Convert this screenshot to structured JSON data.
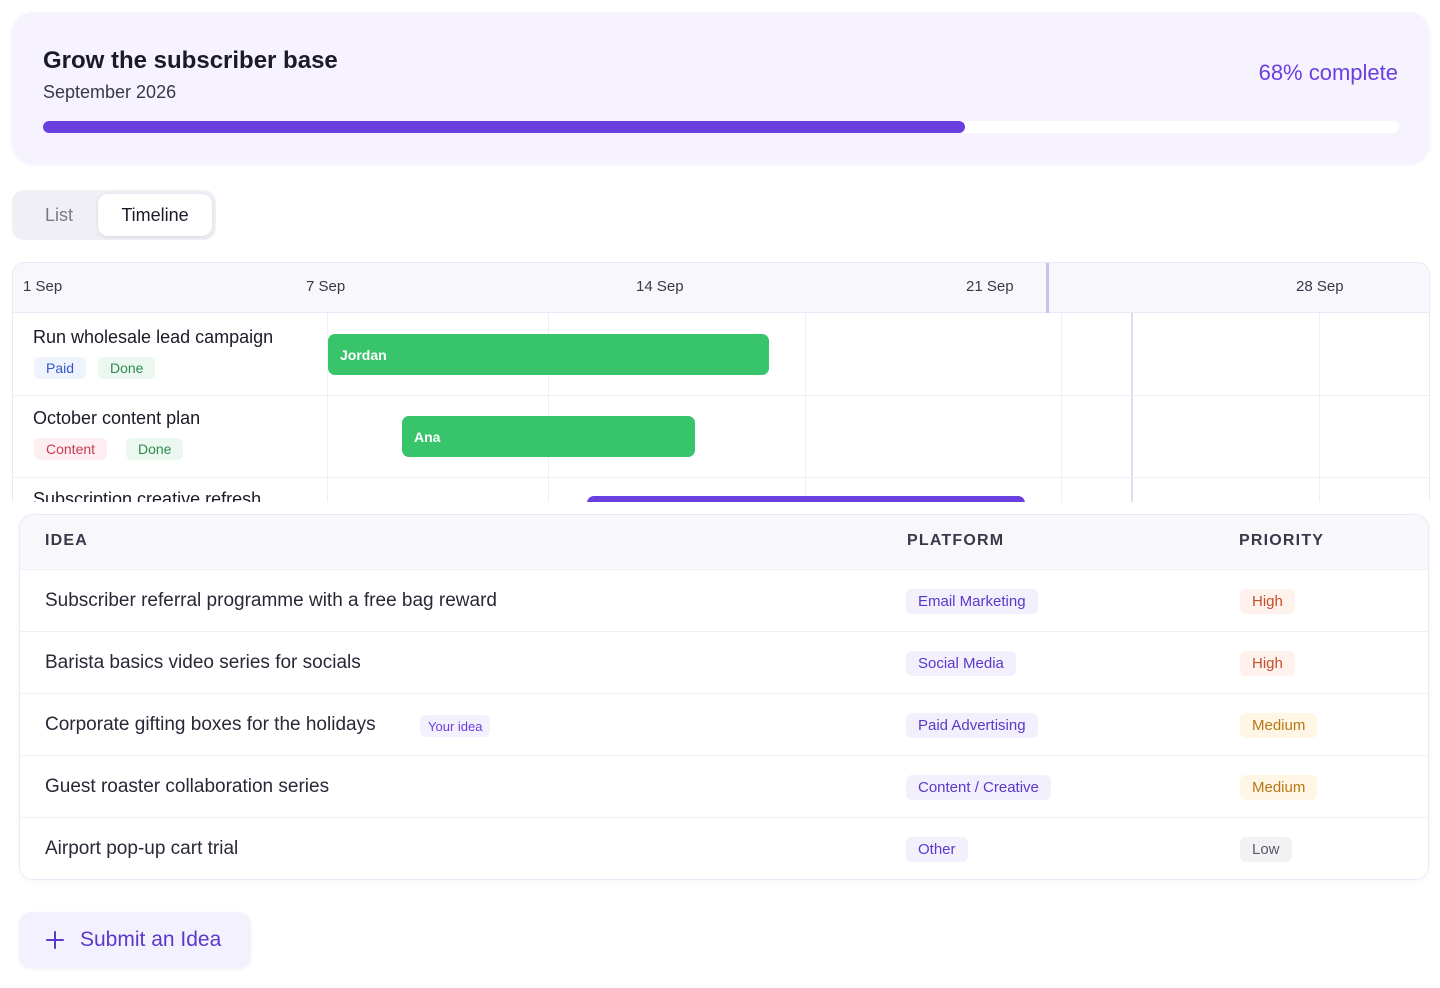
{
  "goal": {
    "title": "Grow the subscriber base",
    "period": "September 2026",
    "progress_label": "68% complete",
    "progress": 0.68,
    "accent": "#6a3fe0"
  },
  "view_toggle": {
    "options": [
      "List",
      "Timeline"
    ],
    "selected": "Timeline"
  },
  "timeline": {
    "dates": [
      "1 Sep",
      "7 Sep",
      "14 Sep",
      "21 Sep",
      "28 Sep"
    ],
    "tasks": [
      {
        "name": "Run wholesale lead campaign",
        "tags": [
          "Paid",
          "Done"
        ],
        "assignee": "Jordan",
        "bar_color": "#38c46a"
      },
      {
        "name": "October content plan",
        "tags": [
          "Content",
          "Done"
        ],
        "assignee": "Ana",
        "bar_color": "#38c46a"
      },
      {
        "name": "Subscription creative refresh",
        "tags": [],
        "assignee": "",
        "bar_color": "#6a3fe0"
      }
    ]
  },
  "ideas": {
    "columns": [
      "IDEA",
      "PLATFORM",
      "PRIORITY"
    ],
    "rows": [
      {
        "idea": "Subscriber referral programme with a free bag reward",
        "badge": "",
        "platform": "Email Marketing",
        "priority": "High"
      },
      {
        "idea": "Barista basics video series for socials",
        "badge": "",
        "platform": "Social Media",
        "priority": "High"
      },
      {
        "idea": "Corporate gifting boxes for the holidays",
        "badge": "Your idea",
        "platform": "Paid Advertising",
        "priority": "Medium"
      },
      {
        "idea": "Guest roaster collaboration series",
        "badge": "",
        "platform": "Content / Creative",
        "priority": "Medium"
      },
      {
        "idea": "Airport pop-up cart trial",
        "badge": "",
        "platform": "Other",
        "priority": "Low"
      }
    ]
  },
  "submit": {
    "label": "Submit an Idea",
    "icon": "plus-icon"
  }
}
